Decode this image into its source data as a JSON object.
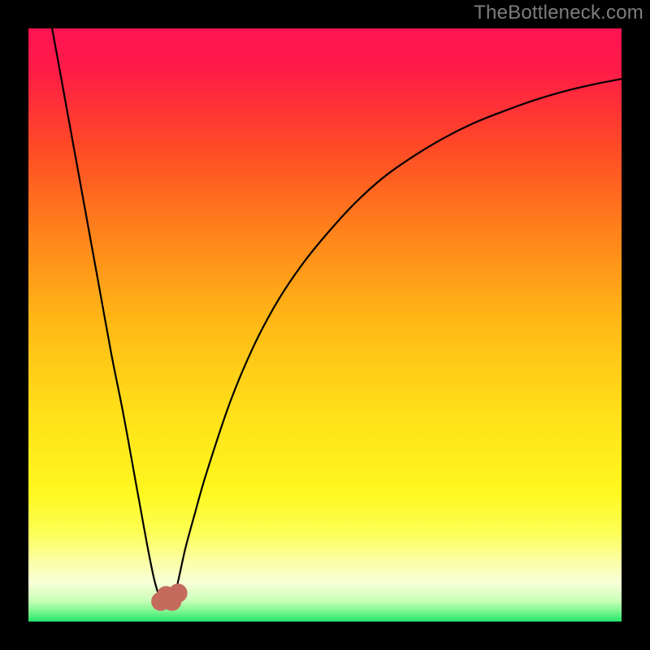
{
  "watermark": "TheBottleneck.com",
  "chart_data": {
    "type": "line",
    "title": "",
    "xlabel": "",
    "ylabel": "",
    "xlim": [
      0,
      100
    ],
    "ylim": [
      0,
      100
    ],
    "background_gradient": {
      "stops": [
        {
          "offset": 0.0,
          "color": "#ff1452"
        },
        {
          "offset": 0.07,
          "color": "#ff1b47"
        },
        {
          "offset": 0.2,
          "color": "#ff4a26"
        },
        {
          "offset": 0.35,
          "color": "#ff851a"
        },
        {
          "offset": 0.5,
          "color": "#ffba16"
        },
        {
          "offset": 0.65,
          "color": "#ffe019"
        },
        {
          "offset": 0.78,
          "color": "#fff81e"
        },
        {
          "offset": 0.85,
          "color": "#fdff55"
        },
        {
          "offset": 0.9,
          "color": "#fbffa8"
        },
        {
          "offset": 0.935,
          "color": "#f7ffd8"
        },
        {
          "offset": 0.965,
          "color": "#c9ffb8"
        },
        {
          "offset": 0.985,
          "color": "#70f58a"
        },
        {
          "offset": 1.0,
          "color": "#22e36b"
        }
      ]
    },
    "series": [
      {
        "name": "bottleneck-curve",
        "x": [
          4.0,
          6.0,
          8.0,
          10.0,
          12.0,
          14.0,
          16.0,
          18.0,
          19.0,
          20.0,
          21.0,
          21.5,
          22.0,
          23.0,
          23.5,
          24.0,
          24.5,
          25.0,
          25.5,
          26.5,
          28.0,
          30.0,
          34.0,
          38.0,
          42.0,
          46.0,
          50.0,
          55.0,
          60.0,
          65.0,
          70.0,
          75.0,
          80.0,
          85.0,
          90.0,
          95.0,
          100.0
        ],
        "y": [
          100.0,
          89.0,
          78.0,
          67.0,
          56.0,
          45.0,
          35.0,
          24.0,
          18.5,
          13.0,
          8.0,
          6.0,
          4.5,
          3.5,
          3.3,
          3.5,
          4.3,
          5.8,
          8.0,
          12.5,
          18.0,
          25.0,
          37.0,
          46.5,
          54.0,
          60.0,
          65.0,
          70.5,
          75.0,
          78.5,
          81.5,
          84.0,
          86.0,
          87.8,
          89.3,
          90.5,
          91.5
        ]
      }
    ],
    "markers": [
      {
        "x": 22.3,
        "y": 3.4,
        "color": "#c46b5e",
        "r": 1.6
      },
      {
        "x": 23.2,
        "y": 4.4,
        "color": "#c46b5e",
        "r": 1.6
      },
      {
        "x": 24.2,
        "y": 3.4,
        "color": "#c46b5e",
        "r": 1.6
      },
      {
        "x": 25.2,
        "y": 4.8,
        "color": "#c46b5e",
        "r": 1.6
      }
    ]
  }
}
